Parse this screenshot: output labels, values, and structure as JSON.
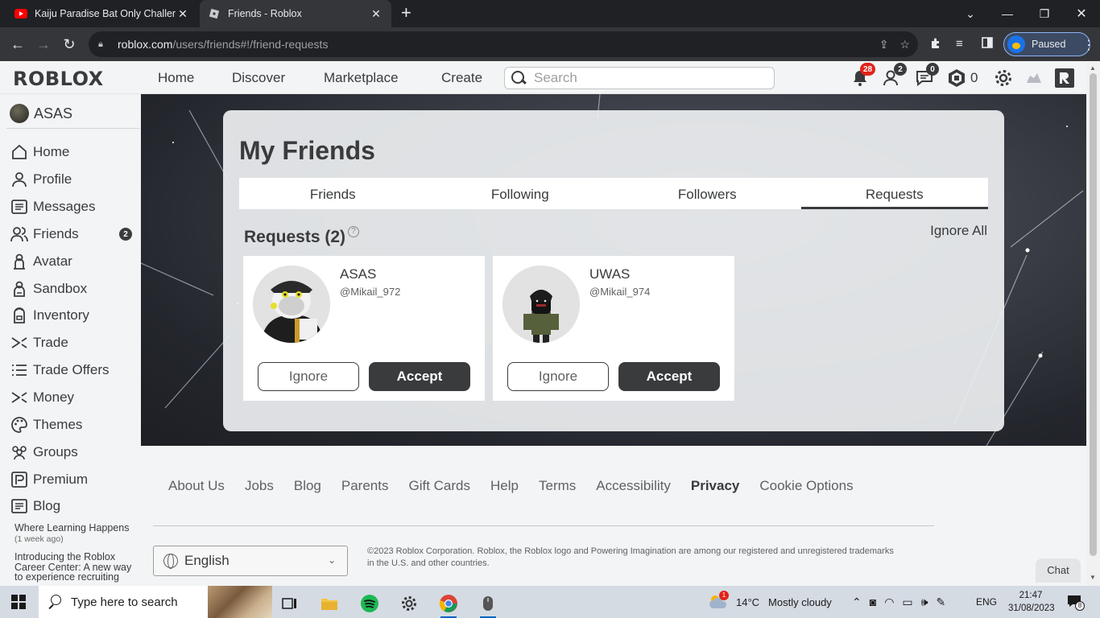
{
  "browser": {
    "tabs": [
      {
        "title": "Kaiju Paradise Bat Only Challenge",
        "icon": "youtube-icon",
        "active": false
      },
      {
        "title": "Friends - Roblox",
        "icon": "roblox-icon",
        "active": true
      }
    ],
    "url_host": "roblox.com",
    "url_path": "/users/friends#!/friend-requests",
    "profile_status": "Paused"
  },
  "header": {
    "logo": "ROBLOX",
    "nav": [
      "Home",
      "Discover",
      "Marketplace",
      "Create"
    ],
    "search_placeholder": "Search",
    "notifications_count": "28",
    "friends_count": "2",
    "messages_count": "0",
    "robux": "0"
  },
  "sidebar": {
    "username": "ASAS",
    "items": [
      {
        "label": "Home",
        "icon": "home-icon"
      },
      {
        "label": "Profile",
        "icon": "profile-icon"
      },
      {
        "label": "Messages",
        "icon": "messages-icon"
      },
      {
        "label": "Friends",
        "icon": "friends-icon",
        "badge": "2"
      },
      {
        "label": "Avatar",
        "icon": "avatar-icon"
      },
      {
        "label": "Sandbox",
        "icon": "sandbox-icon"
      },
      {
        "label": "Inventory",
        "icon": "inventory-icon"
      },
      {
        "label": "Trade",
        "icon": "trade-icon"
      },
      {
        "label": "Trade Offers",
        "icon": "trade-offers-icon"
      },
      {
        "label": "Money",
        "icon": "money-icon"
      },
      {
        "label": "Themes",
        "icon": "themes-icon"
      },
      {
        "label": "Groups",
        "icon": "groups-icon"
      },
      {
        "label": "Premium",
        "icon": "premium-icon"
      },
      {
        "label": "Blog",
        "icon": "blog-icon"
      }
    ],
    "blog_posts": [
      {
        "title": "Where Learning Happens",
        "ago": "(1 week ago)"
      },
      {
        "title": "Introducing the Roblox Career Center: A new way to experience recruiting"
      }
    ]
  },
  "main": {
    "title": "My Friends",
    "tabs": [
      "Friends",
      "Following",
      "Followers",
      "Requests"
    ],
    "active_tab": "Requests",
    "requests_heading": "Requests (2)",
    "ignore_all": "Ignore All",
    "requests": [
      {
        "display_name": "ASAS",
        "username": "@Mikail_972",
        "ignore": "Ignore",
        "accept": "Accept"
      },
      {
        "display_name": "UWAS",
        "username": "@Mikail_974",
        "ignore": "Ignore",
        "accept": "Accept"
      }
    ]
  },
  "footer": {
    "links": [
      "About Us",
      "Jobs",
      "Blog",
      "Parents",
      "Gift Cards",
      "Help",
      "Terms",
      "Accessibility",
      "Privacy",
      "Cookie Options"
    ],
    "language": "English",
    "copyright": "©2023 Roblox Corporation. Roblox, the Roblox logo and Powering Imagination are among our registered and unregistered trademarks in the U.S. and other countries.",
    "chat": "Chat"
  },
  "taskbar": {
    "search_placeholder": "Type here to search",
    "weather_temp": "14°C",
    "weather_desc": "Mostly cloudy",
    "weather_badge": "1",
    "language": "ENG",
    "time": "21:47",
    "date": "31/08/2023",
    "notif_count": "8"
  },
  "colors": {
    "roblox_dark": "#393b3d",
    "notification_red": "#e2231a",
    "chrome_dark": "#202124"
  }
}
